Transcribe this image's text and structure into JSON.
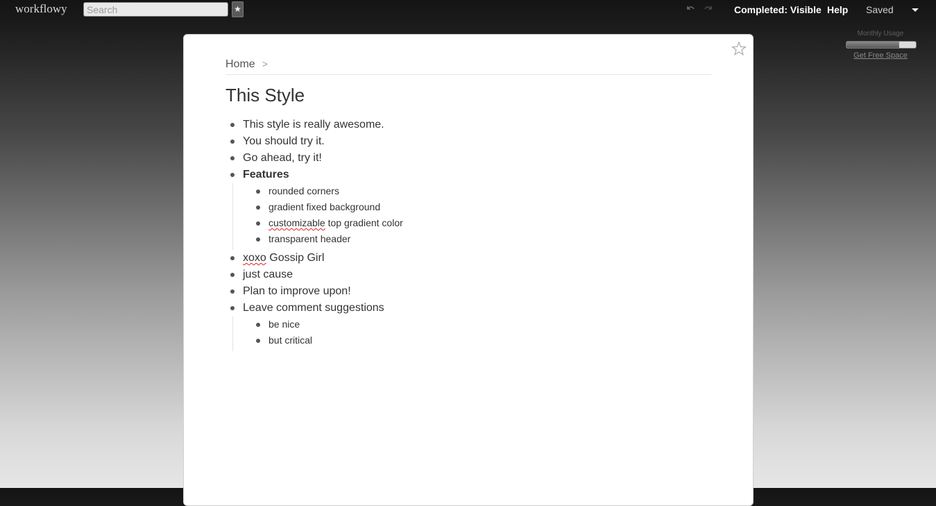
{
  "app": {
    "logo": "workflowy"
  },
  "header": {
    "search_placeholder": "Search",
    "star_label": "★",
    "completed": "Completed: Visible",
    "help": "Help",
    "saved": "Saved"
  },
  "usage": {
    "label": "Monthly Usage",
    "fraction": 0.76,
    "link": "Get Free Space"
  },
  "page": {
    "breadcrumb": {
      "home": "Home",
      "separator": ">"
    },
    "title": "This Style",
    "items": [
      {
        "text": "This style is really awesome."
      },
      {
        "text": "You should try it."
      },
      {
        "text": "Go ahead, try it!"
      },
      {
        "text": "Features",
        "children": [
          {
            "text": "rounded corners"
          },
          {
            "text": "gradient fixed background"
          },
          {
            "text_a": "customizable",
            "text_b": " top gradient color"
          },
          {
            "text": "transparent header"
          }
        ]
      },
      {
        "text_a": "xoxo",
        "text_b": " Gossip Girl"
      },
      {
        "text": "just cause"
      },
      {
        "text": "Plan to improve upon!"
      },
      {
        "text": "Leave comment suggestions",
        "children": [
          {
            "text": "be nice"
          },
          {
            "text": "but critical"
          }
        ]
      }
    ]
  },
  "icons": {
    "undo": "undo-icon",
    "redo": "redo-icon",
    "star": "star-icon",
    "menu": "chevron-down-icon"
  },
  "colors": {
    "header_text": "#ffffff",
    "bullet": "#555555",
    "spellcheck": "#dd2222"
  }
}
